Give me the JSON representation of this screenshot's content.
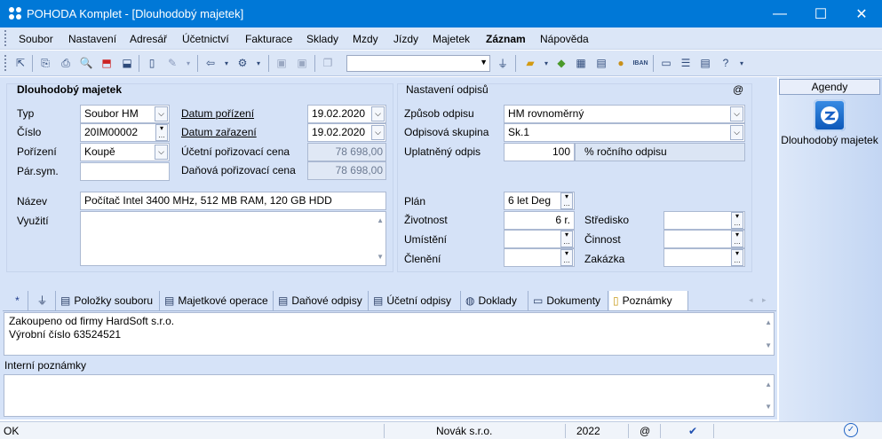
{
  "window": {
    "title": "POHODA Komplet - [Dlouhodobý majetek]",
    "minimize": "—",
    "maximize": "☐",
    "close": "✕"
  },
  "menu": [
    "Soubor",
    "Nastavení",
    "Adresář",
    "Účetnictví",
    "Fakturace",
    "Sklady",
    "Mzdy",
    "Jízdy",
    "Majetek",
    "Záznam",
    "Nápověda"
  ],
  "toolbar": {
    "combo_value": ""
  },
  "asset": {
    "group_title": "Dlouhodobý majetek",
    "labels": {
      "typ": "Typ",
      "cislo": "Číslo",
      "porizeni": "Pořízení",
      "parsym": "Pár.sym."
    },
    "typ": "Soubor HM",
    "cislo": "20IM00002",
    "porizeni": "Koupě",
    "parsym": "",
    "datum_porizeni_label": "Datum pořízení",
    "datum_porizeni": "19.02.2020",
    "datum_zarazeni_label": "Datum zařazení",
    "datum_zarazeni": "19.02.2020",
    "ucetni_cena_label": "Účetní pořizovací cena",
    "ucetni_cena": "78 698,00",
    "danova_cena_label": "Daňová pořizovací cena",
    "danova_cena": "78 698,00",
    "nazev_label": "Název",
    "nazev": "Počítač Intel 3400 MHz, 512 MB RAM, 120 GB HDD",
    "vyuziti_label": "Využití",
    "vyuziti": ""
  },
  "depreciation": {
    "group_title": "Nastavení odpisů",
    "at": "@",
    "zpusob_label": "Způsob odpisu",
    "zpusob": "HM rovnoměrný",
    "skupina_label": "Odpisová skupina",
    "skupina": "Sk.1",
    "uplatneny_label": "Uplatněný odpis",
    "uplatneny": "100",
    "uplatneny_unit": "% ročního odpisu",
    "plan_label": "Plán",
    "plan": "6 let Deg",
    "zivotnost_label": "Životnost",
    "zivotnost": "6 r.",
    "umisteni_label": "Umístění",
    "cleneni_label": "Členění",
    "stredisko_label": "Středisko",
    "cinnost_label": "Činnost",
    "zakazka_label": "Zakázka"
  },
  "tabs": [
    {
      "label": "*",
      "icon": "asterisk-icon"
    },
    {
      "label": "",
      "icon": "filter-icon"
    },
    {
      "label": "Položky souboru",
      "icon": "table-icon"
    },
    {
      "label": "Majetkové operace",
      "icon": "table-icon"
    },
    {
      "label": "Daňové odpisy",
      "icon": "table-icon"
    },
    {
      "label": "Účetní odpisy",
      "icon": "table-icon"
    },
    {
      "label": "Doklady",
      "icon": "doc-icon"
    },
    {
      "label": "Dokumenty",
      "icon": "folder-icon"
    },
    {
      "label": "Poznámky",
      "icon": "note-icon"
    }
  ],
  "notes": {
    "line1": "Zakoupeno od firmy HardSoft s.r.o.",
    "line2": "Výrobní číslo 63524521",
    "interni_label": "Interní poznámky",
    "interni": ""
  },
  "agendy": {
    "title": "Agendy",
    "item": "Dlouhodobý majetek"
  },
  "status": {
    "ok": "OK",
    "firma": "Novák s.r.o.",
    "rok": "2022",
    "at": "@"
  }
}
